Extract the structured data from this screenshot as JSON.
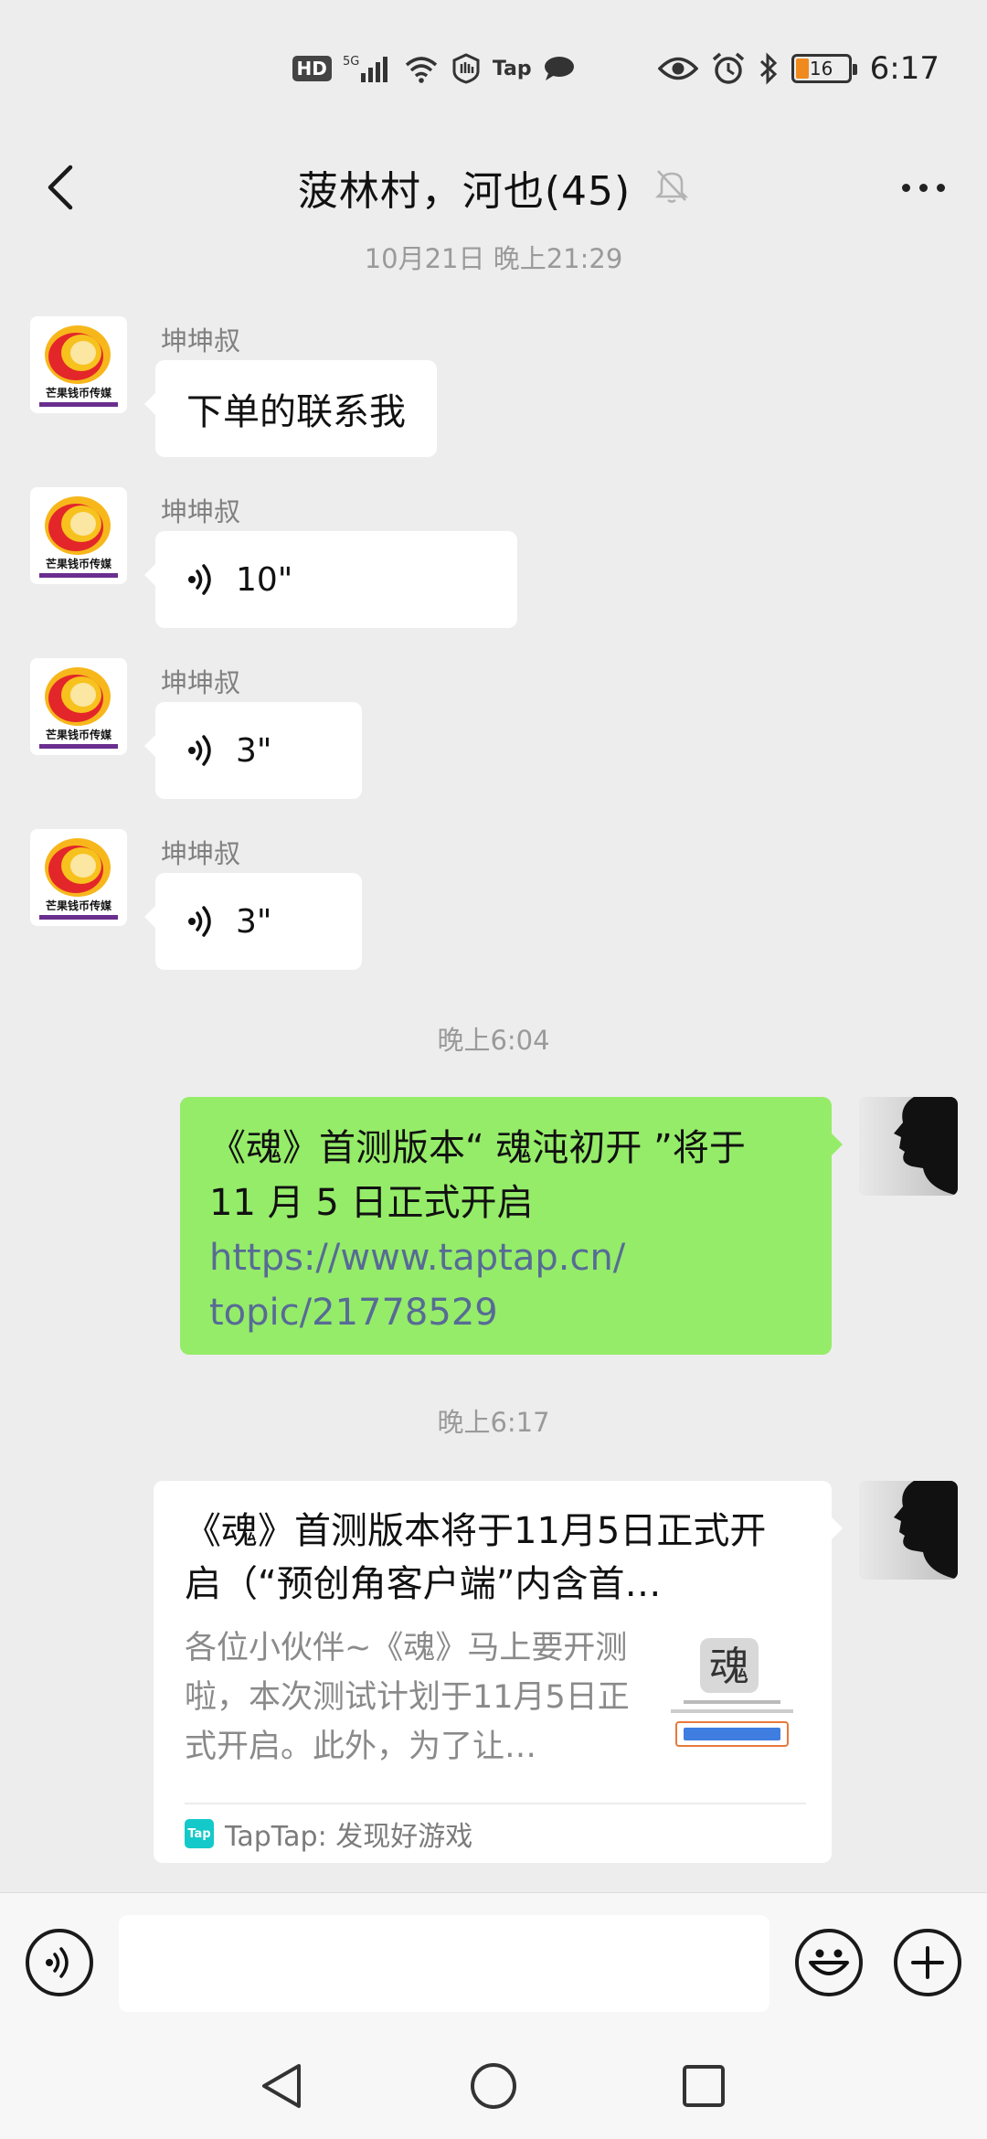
{
  "status_bar": {
    "hd_label": "HD",
    "network_label": "5G",
    "tap_label": "Tap",
    "battery_level": "16",
    "time": "6:17",
    "icons": [
      "hd-icon",
      "signal-icon",
      "wifi-icon",
      "hand-icon",
      "tap-icon",
      "chat-bubble-icon",
      "eye-icon",
      "alarm-icon",
      "bluetooth-icon",
      "battery-icon"
    ]
  },
  "header": {
    "title": "菠林村，河也(45)",
    "muted": true,
    "back_icon": "chevron-left-icon",
    "more_icon": "more-dots-icon"
  },
  "timestamps": [
    "10月21日 晚上21:29",
    "晚上6:04",
    "晚上6:17"
  ],
  "incoming": {
    "sender": "坤坤叔",
    "avatar_text": "芒果钱币传媒",
    "messages": [
      {
        "type": "text",
        "text": "下单的联系我"
      },
      {
        "type": "voice",
        "duration": "10\""
      },
      {
        "type": "voice",
        "duration": "3\""
      },
      {
        "type": "voice",
        "duration": "3\""
      }
    ]
  },
  "outgoing_text": {
    "line1": "《魂》首测版本“ 魂沌初开 ”将于",
    "line2": "11 月 5 日正式开启",
    "link1": "https://www.taptap.cn/",
    "link2": "topic/21778529"
  },
  "link_card": {
    "title": "《魂》首测版本将于11月5日正式开启（“预创角客户端”内含首…",
    "desc": "各位小伙伴~《魂》马上要开测啦，本次测试计划于11月5日正式开启。此外，为了让…",
    "source": "TapTap: 发现好游戏",
    "source_logo": "Tap",
    "thumb_text": "魂"
  },
  "input_bar": {
    "voice_icon": "voice-toggle-icon",
    "emoji_icon": "emoji-icon",
    "plus_icon": "plus-icon",
    "placeholder": ""
  },
  "nav": [
    "back-triangle-icon",
    "home-circle-icon",
    "recents-square-icon"
  ],
  "colors": {
    "background": "#ededed",
    "outgoing_bubble": "#95ec69",
    "link": "#576b95",
    "battery": "#f08a1c"
  }
}
